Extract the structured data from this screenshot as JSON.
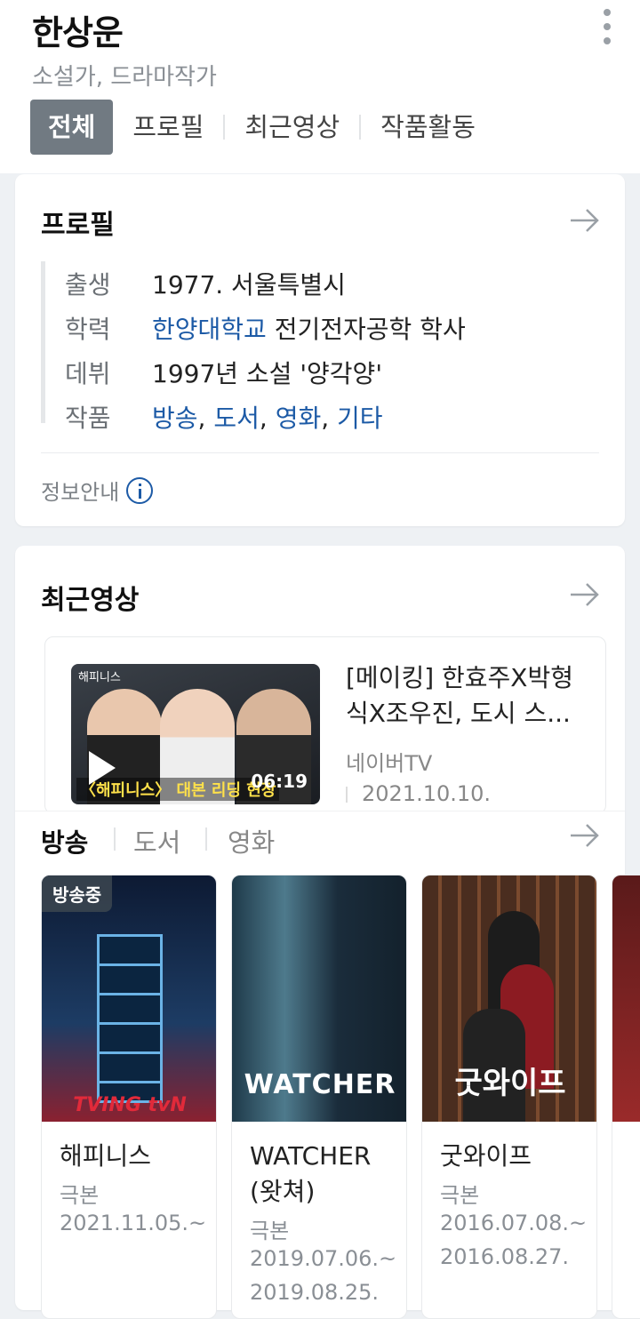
{
  "person": {
    "name": "한상운",
    "occupation": "소설가, 드라마작가"
  },
  "tabs": [
    "전체",
    "프로필",
    "최근영상",
    "작품활동"
  ],
  "profile": {
    "title": "프로필",
    "birth": {
      "label": "출생",
      "value": "1977. 서울특별시"
    },
    "education": {
      "label": "학력",
      "school": "한양대학교",
      "detail": "전기전자공학 학사"
    },
    "debut": {
      "label": "데뷔",
      "value": "1997년 소설 '양각양'"
    },
    "works": {
      "label": "작품",
      "items": [
        "방송",
        "도서",
        "영화",
        "기타"
      ],
      "separator": ","
    },
    "info_label": "정보안내"
  },
  "recent_videos": {
    "title": "최근영상",
    "video": {
      "title": "[메이킹] 한효주X박형식X조우진, 도시 스...",
      "source": "네이버TV",
      "date": "2021.10.10.",
      "duration": "06:19",
      "thumb_tag": "해피니스",
      "thumb_caption": "〈해피니스〉 대본 리딩 현장"
    }
  },
  "works_tabs": [
    "방송",
    "도서",
    "영화"
  ],
  "works": [
    {
      "title": "해피니스",
      "type": "극본",
      "dates": [
        "2021.11.05.~"
      ],
      "badge": "방송중",
      "poster_mark": "TVING tvN"
    },
    {
      "title": "WATCHER (왓쳐)",
      "type": "극본",
      "dates": [
        "2019.07.06.~",
        "2019.08.25."
      ],
      "poster_mark": "WATCHER"
    },
    {
      "title": "굿와이프",
      "type": "극본",
      "dates": [
        "2016.07.08.~",
        "2016.08.27."
      ],
      "poster_mark": "굿와이프"
    }
  ],
  "colors": {
    "link": "#1c5aa6",
    "active_tab_bg": "#717a82",
    "page_bg": "#eef1f4"
  }
}
